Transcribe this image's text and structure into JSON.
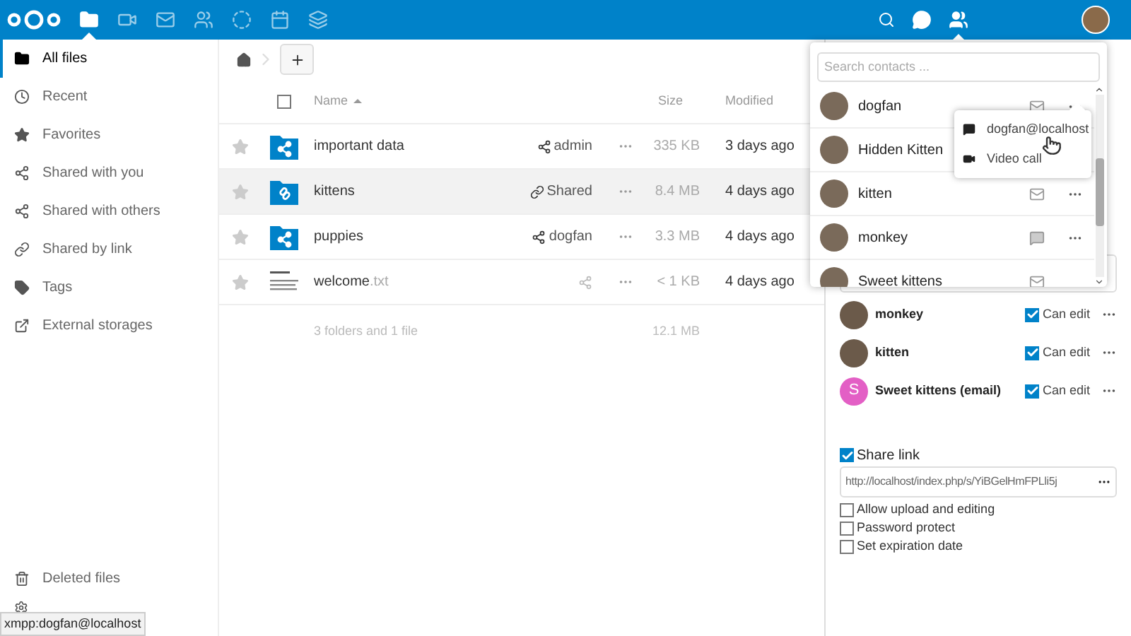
{
  "header": {
    "apps": [
      {
        "kind": "files",
        "selected": true
      },
      {
        "kind": "video",
        "selected": false
      },
      {
        "kind": "mail",
        "selected": false
      },
      {
        "kind": "contacts",
        "selected": false
      },
      {
        "kind": "circles",
        "selected": false
      },
      {
        "kind": "calendar",
        "selected": false
      },
      {
        "kind": "deck",
        "selected": false
      }
    ],
    "contacts_menu_open": true
  },
  "sidebar": {
    "items": [
      {
        "kind": "folder",
        "label": "All files",
        "selected": true
      },
      {
        "kind": "clock",
        "label": "Recent",
        "selected": false
      },
      {
        "kind": "star",
        "label": "Favorites",
        "selected": false
      },
      {
        "kind": "share",
        "label": "Shared with you",
        "selected": false
      },
      {
        "kind": "share",
        "label": "Shared with others",
        "selected": false
      },
      {
        "kind": "link",
        "label": "Shared by link",
        "selected": false
      },
      {
        "kind": "tag",
        "label": "Tags",
        "selected": false
      },
      {
        "kind": "external",
        "label": "External storages",
        "selected": false
      }
    ],
    "bottom_items": [
      {
        "kind": "trash",
        "label": "Deleted files"
      }
    ]
  },
  "file_table": {
    "select_all": {
      "checked": false
    },
    "columns": [
      "Name",
      "Size",
      "Modified"
    ],
    "rows": [
      {
        "kind": "shared_folder",
        "name": "important data",
        "extension": "",
        "share": {
          "kind": "user",
          "label": "admin"
        },
        "size": "335 KB",
        "modified": "3 days ago",
        "selected": false
      },
      {
        "kind": "link_folder",
        "name": "kittens",
        "extension": "",
        "share": {
          "kind": "link",
          "label": "Shared"
        },
        "size": "8.4 MB",
        "modified": "4 days ago",
        "selected": true
      },
      {
        "kind": "shared_folder",
        "name": "puppies",
        "extension": "",
        "share": {
          "kind": "user",
          "label": "dogfan"
        },
        "size": "3.3 MB",
        "modified": "4 days ago",
        "selected": false
      },
      {
        "kind": "text_file",
        "name": "welcome",
        "extension": ".txt",
        "share": {
          "kind": "unshared"
        },
        "size": "< 1 KB",
        "modified": "4 days ago",
        "selected": false
      }
    ],
    "summary": {
      "text": "3 folders and 1 file",
      "size": "12.1 MB"
    }
  },
  "contacts_popover": {
    "search": {
      "placeholder": "Search contacts ..."
    },
    "contacts": [
      {
        "kind": "mail",
        "name": "dogfan",
        "menu": true
      },
      {
        "kind": "plain",
        "name": "Hidden Kitten",
        "menu": false
      },
      {
        "kind": "mail",
        "name": "kitten",
        "menu": true
      },
      {
        "kind": "chat",
        "name": "monkey",
        "menu": true
      },
      {
        "kind": "mail",
        "name": "Sweet kittens",
        "menu": false
      }
    ]
  },
  "contact_menu": {
    "items": [
      {
        "kind": "chat",
        "label": "dogfan@localhost"
      },
      {
        "kind": "video",
        "label": "Video call"
      }
    ]
  },
  "sharing": {
    "shares": [
      {
        "kind": "photo",
        "name": "monkey",
        "permission_label": "Can edit",
        "can_edit": true
      },
      {
        "kind": "photo",
        "name": "kitten",
        "permission_label": "Can edit",
        "can_edit": true
      },
      {
        "kind": "letter",
        "name": "Sweet kittens (email)",
        "initial": "S",
        "color": "#e35fc5",
        "permission_label": "Can edit",
        "can_edit": true
      }
    ],
    "share_link": {
      "label": "Share link",
      "checked": true,
      "url": "http://localhost/index.php/s/YiBGelHmFPLli5j",
      "options": [
        {
          "label": "Allow upload and editing",
          "checked": false
        },
        {
          "label": "Password protect",
          "checked": false
        },
        {
          "label": "Set expiration date",
          "checked": false
        }
      ]
    }
  },
  "tooltip": {
    "text": "xmpp:dogfan@localhost"
  }
}
